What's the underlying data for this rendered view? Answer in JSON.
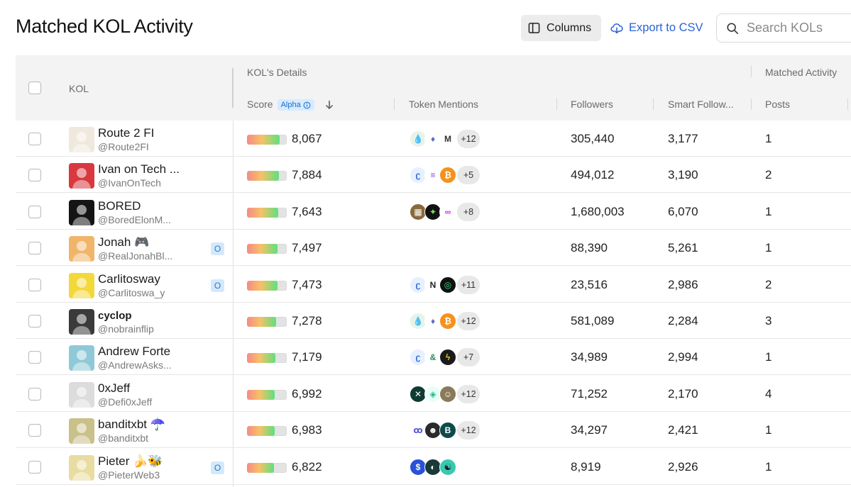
{
  "page": {
    "title": "Matched KOL Activity"
  },
  "toolbar": {
    "columns_label": "Columns",
    "export_label": "Export to CSV",
    "search_placeholder": "Search KOLs"
  },
  "table": {
    "group_headers": {
      "kol_details": "KOL's Details",
      "matched_activity": "Matched Activity"
    },
    "columns": {
      "kol": "KOL",
      "score": "Score",
      "score_badge": "Alpha",
      "token_mentions": "Token Mentions",
      "followers": "Followers",
      "smart_followers": "Smart Follow...",
      "posts": "Posts"
    },
    "rows": [
      {
        "name": "Route 2 FI",
        "handle": "@Route2FI",
        "badge": "",
        "score": "8,067",
        "score_level": 0.82,
        "tokens": [
          {
            "icon": "drop-icon",
            "bg": "#e8f3e8",
            "fg": "#2c8a3a",
            "glyph": "💧"
          },
          {
            "icon": "ethereum-icon",
            "bg": "#ffffff",
            "fg": "#5c6bc0",
            "glyph": "♦"
          },
          {
            "icon": "m-token-icon",
            "bg": "#ffffff",
            "fg": "#333333",
            "glyph": "M"
          }
        ],
        "more": "+12",
        "followers": "305,440",
        "smart_followers": "3,177",
        "posts": "1",
        "avatar_color": "#efe9dd"
      },
      {
        "name": "Ivan on Tech ...",
        "handle": "@IvanOnTech",
        "badge": "",
        "score": "7,884",
        "score_level": 0.8,
        "tokens": [
          {
            "icon": "swirl-icon",
            "bg": "#e6f0ff",
            "fg": "#2a6ad8",
            "glyph": "ʗ"
          },
          {
            "icon": "solana-icon",
            "bg": "#ffffff",
            "fg": "#8a4ce0",
            "glyph": "≡"
          },
          {
            "icon": "bitcoin-icon",
            "bg": "#f3921d",
            "fg": "#ffffff",
            "glyph": "₿"
          }
        ],
        "more": "+5",
        "followers": "494,012",
        "smart_followers": "3,190",
        "posts": "2",
        "avatar_color": "#d9383e"
      },
      {
        "name": "BORED",
        "handle": "@BoredElonM...",
        "badge": "",
        "score": "7,643",
        "score_level": 0.78,
        "tokens": [
          {
            "icon": "film-icon",
            "bg": "#8a6a3a",
            "fg": "#ffffff",
            "glyph": "▦"
          },
          {
            "icon": "bonk-icon",
            "bg": "#111111",
            "fg": "#7de35a",
            "glyph": "✦"
          },
          {
            "icon": "infinity-icon",
            "bg": "#ffffff",
            "fg": "#c23ad8",
            "glyph": "∞"
          }
        ],
        "more": "+8",
        "followers": "1,680,003",
        "smart_followers": "6,070",
        "posts": "1",
        "avatar_color": "#141414"
      },
      {
        "name": "Jonah 🎮",
        "handle": "@RealJonahBl...",
        "badge": "O",
        "score": "7,497",
        "score_level": 0.76,
        "tokens": [],
        "more": "",
        "followers": "88,390",
        "smart_followers": "5,261",
        "posts": "1",
        "avatar_color": "#f0b56b"
      },
      {
        "name": "Carlitosway",
        "handle": "@Carlitoswa_y",
        "badge": "O",
        "score": "7,473",
        "score_level": 0.76,
        "tokens": [
          {
            "icon": "swirl-icon",
            "bg": "#e6f0ff",
            "fg": "#2a6ad8",
            "glyph": "ʗ"
          },
          {
            "icon": "nom-icon",
            "bg": "#ffffff",
            "fg": "#222222",
            "glyph": "N"
          },
          {
            "icon": "ring-icon",
            "bg": "#111111",
            "fg": "#3ddc84",
            "glyph": "◎"
          }
        ],
        "more": "+11",
        "followers": "23,516",
        "smart_followers": "2,986",
        "posts": "2",
        "avatar_color": "#f4d83a"
      },
      {
        "name": "cyclop",
        "handle": "@nobrainflip",
        "badge": "",
        "score": "7,278",
        "score_level": 0.74,
        "tokens": [
          {
            "icon": "drop-icon",
            "bg": "#e8f3e8",
            "fg": "#2c8a3a",
            "glyph": "💧"
          },
          {
            "icon": "ethereum-icon",
            "bg": "#ffffff",
            "fg": "#5c6bc0",
            "glyph": "♦"
          },
          {
            "icon": "bitcoin-icon",
            "bg": "#f3921d",
            "fg": "#ffffff",
            "glyph": "₿"
          }
        ],
        "more": "+12",
        "followers": "581,089",
        "smart_followers": "2,284",
        "posts": "3",
        "avatar_color": "#3a3a3a"
      },
      {
        "name": "Andrew Forte",
        "handle": "@AndrewAsks...",
        "badge": "",
        "score": "7,179",
        "score_level": 0.72,
        "tokens": [
          {
            "icon": "swirl-icon",
            "bg": "#e6f0ff",
            "fg": "#2a6ad8",
            "glyph": "ʗ"
          },
          {
            "icon": "link-icon",
            "bg": "#ffffff",
            "fg": "#2a8a5a",
            "glyph": "&"
          },
          {
            "icon": "bolt-icon",
            "bg": "#1b1b1b",
            "fg": "#e0c52a",
            "glyph": "ϟ"
          }
        ],
        "more": "+7",
        "followers": "34,989",
        "smart_followers": "2,994",
        "posts": "1",
        "avatar_color": "#8fc9d8"
      },
      {
        "name": "0xJeff",
        "handle": "@Defi0xJeff",
        "badge": "",
        "score": "6,992",
        "score_level": 0.7,
        "tokens": [
          {
            "icon": "x-token-icon",
            "bg": "#0f3b33",
            "fg": "#ffffff",
            "glyph": "✕"
          },
          {
            "icon": "gem-icon",
            "bg": "#e6fff6",
            "fg": "#27b58a",
            "glyph": "◈"
          },
          {
            "icon": "face-icon",
            "bg": "#8a7a5a",
            "fg": "#ffffff",
            "glyph": "☺"
          }
        ],
        "more": "+12",
        "followers": "71,252",
        "smart_followers": "2,170",
        "posts": "4",
        "avatar_color": "#dcdcdc"
      },
      {
        "name": "banditxbt ☂️",
        "handle": "@banditxbt",
        "badge": "",
        "score": "6,983",
        "score_level": 0.7,
        "tokens": [
          {
            "icon": "loop-icon",
            "bg": "#ffffff",
            "fg": "#5a5ad8",
            "glyph": "ꝏ"
          },
          {
            "icon": "portrait-icon",
            "bg": "#2a2a2a",
            "fg": "#ffffff",
            "glyph": "☻"
          },
          {
            "icon": "b-token-icon",
            "bg": "#0f4a4a",
            "fg": "#ffffff",
            "glyph": "B"
          }
        ],
        "more": "+12",
        "followers": "34,297",
        "smart_followers": "2,421",
        "posts": "1",
        "avatar_color": "#c9c08a"
      },
      {
        "name": "Pieter 🍌🐝",
        "handle": "@PieterWeb3",
        "badge": "O",
        "score": "6,822",
        "score_level": 0.68,
        "tokens": [
          {
            "icon": "blue-coin-icon",
            "bg": "#2a52d8",
            "fg": "#ffffff",
            "glyph": "$"
          },
          {
            "icon": "dark-coin-icon",
            "bg": "#1a3a3a",
            "fg": "#ffffff",
            "glyph": "◐"
          },
          {
            "icon": "brain-icon",
            "bg": "#3ac9b0",
            "fg": "#1a1a1a",
            "glyph": "☯"
          }
        ],
        "more": "",
        "followers": "8,919",
        "smart_followers": "2,926",
        "posts": "1",
        "avatar_color": "#e8dca0"
      }
    ]
  }
}
